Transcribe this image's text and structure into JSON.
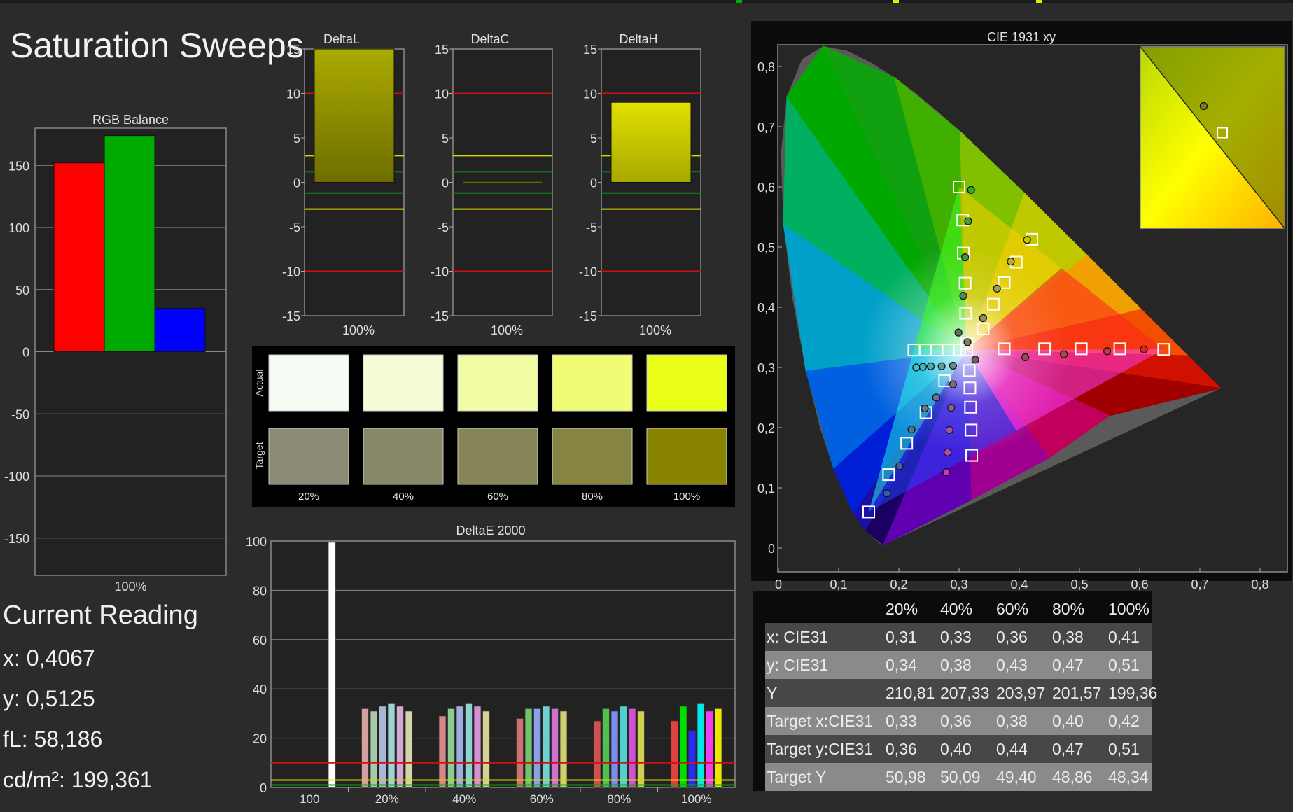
{
  "title": "Saturation Sweeps",
  "topbar_colors": [
    "#00b000",
    "#e8e800",
    "#e8e800"
  ],
  "current_reading": {
    "heading": "Current Reading",
    "x": "x: 0,4067",
    "y": "y: 0,5125",
    "fl": "fL: 58,186",
    "cdm2": "cd/m²: 199,361"
  },
  "swatches": {
    "actual_label": "Actual",
    "target_label": "Target",
    "labels": [
      "20%",
      "40%",
      "60%",
      "80%",
      "100%"
    ],
    "actual_colors": [
      "#f4fcf4",
      "#f4fcd6",
      "#f2fca4",
      "#f0fc74",
      "#eaff18"
    ],
    "target_colors": [
      "#8b8a74",
      "#888868",
      "#858558",
      "#868440",
      "#888400"
    ]
  },
  "table": {
    "headers": [
      "",
      "20%",
      "40%",
      "60%",
      "80%",
      "100%"
    ],
    "rows": [
      [
        "x: CIE31",
        "0,31",
        "0,33",
        "0,36",
        "0,38",
        "0,41"
      ],
      [
        "y: CIE31",
        "0,34",
        "0,38",
        "0,43",
        "0,47",
        "0,51"
      ],
      [
        "Y",
        "210,81",
        "207,33",
        "203,97",
        "201,57",
        "199,36"
      ],
      [
        "Target x:CIE31",
        "0,33",
        "0,36",
        "0,38",
        "0,40",
        "0,42"
      ],
      [
        "Target y:CIE31",
        "0,36",
        "0,40",
        "0,44",
        "0,47",
        "0,51"
      ],
      [
        "Target Y",
        "50,98",
        "50,09",
        "49,40",
        "48,86",
        "48,34"
      ]
    ]
  },
  "chart_data": [
    {
      "type": "bar",
      "title": "RGB Balance",
      "categories": [
        "100%"
      ],
      "series": [
        {
          "name": "Red",
          "color": "#ff0000",
          "values": [
            152
          ]
        },
        {
          "name": "Green",
          "color": "#00aa00",
          "values": [
            174
          ]
        },
        {
          "name": "Blue",
          "color": "#0000ff",
          "values": [
            35
          ]
        }
      ],
      "ylim": [
        -180,
        180
      ],
      "yticks": [
        150,
        100,
        50,
        0,
        -50,
        -100,
        -150
      ]
    },
    {
      "type": "bar",
      "title": "DeltaL",
      "categories": [
        "100%"
      ],
      "values": [
        15
      ],
      "ylim": [
        -15,
        15
      ],
      "yticks": [
        15,
        10,
        5,
        0,
        -5,
        -10,
        -15
      ],
      "bar_color": "#999900"
    },
    {
      "type": "bar",
      "title": "DeltaC",
      "categories": [
        "100%"
      ],
      "values": [
        0.1
      ],
      "ylim": [
        -15,
        15
      ],
      "yticks": [
        15,
        10,
        5,
        0,
        -5,
        -10,
        -15
      ],
      "bar_color": "#999900"
    },
    {
      "type": "bar",
      "title": "DeltaH",
      "categories": [
        "100%"
      ],
      "values": [
        9
      ],
      "ylim": [
        -15,
        15
      ],
      "yticks": [
        15,
        10,
        5,
        0,
        -5,
        -10,
        -15
      ],
      "bar_color": "#cccc00"
    },
    {
      "type": "bar",
      "title": "DeltaE 2000",
      "ylim": [
        0,
        100
      ],
      "yticks": [
        100,
        80,
        60,
        40,
        20,
        0
      ],
      "categories": [
        "100",
        "20%",
        "40%",
        "60%",
        "80%",
        "100%"
      ],
      "threshold_lines": [
        {
          "value": 10,
          "color": "#d01010"
        },
        {
          "value": 3,
          "color": "#d8d800"
        },
        {
          "value": 1,
          "color": "#10a010"
        }
      ],
      "groups": [
        {
          "label": "100",
          "bars": [
            {
              "value": 99.5,
              "color": "#ffffff"
            }
          ]
        },
        {
          "label": "20%",
          "bars": [
            {
              "value": 32,
              "color": "#d4a0a0"
            },
            {
              "value": 31,
              "color": "#a8c8a8"
            },
            {
              "value": 33,
              "color": "#a8b8d4"
            },
            {
              "value": 34,
              "color": "#a0d4d4"
            },
            {
              "value": 33,
              "color": "#d4a8d4"
            },
            {
              "value": 31,
              "color": "#d4d4a8"
            }
          ]
        },
        {
          "label": "40%",
          "bars": [
            {
              "value": 29,
              "color": "#d48888"
            },
            {
              "value": 32,
              "color": "#8ccc8c"
            },
            {
              "value": 33,
              "color": "#9aaee0"
            },
            {
              "value": 34,
              "color": "#8cd4d4"
            },
            {
              "value": 33,
              "color": "#d490d4"
            },
            {
              "value": 31,
              "color": "#d4d490"
            }
          ]
        },
        {
          "label": "60%",
          "bars": [
            {
              "value": 28,
              "color": "#d07070"
            },
            {
              "value": 32,
              "color": "#70c470"
            },
            {
              "value": 32,
              "color": "#8aa0e8"
            },
            {
              "value": 33,
              "color": "#70d0d0"
            },
            {
              "value": 32,
              "color": "#d070d0"
            },
            {
              "value": 31,
              "color": "#d0d070"
            }
          ]
        },
        {
          "label": "80%",
          "bars": [
            {
              "value": 27,
              "color": "#d05050"
            },
            {
              "value": 32,
              "color": "#50c050"
            },
            {
              "value": 31,
              "color": "#7a8cf0"
            },
            {
              "value": 33,
              "color": "#50d0d0"
            },
            {
              "value": 32,
              "color": "#d050d0"
            },
            {
              "value": 31,
              "color": "#d0d050"
            }
          ]
        },
        {
          "label": "100%",
          "bars": [
            {
              "value": 27,
              "color": "#e04040"
            },
            {
              "value": 33,
              "color": "#00e000"
            },
            {
              "value": 23,
              "color": "#2828ff"
            },
            {
              "value": 34,
              "color": "#00e8e8"
            },
            {
              "value": 31,
              "color": "#f040f0"
            },
            {
              "value": 32,
              "color": "#e8e800"
            }
          ]
        }
      ]
    },
    {
      "type": "scatter",
      "title": "CIE 1931 xy",
      "xlim": [
        0,
        0.85
      ],
      "ylim": [
        0,
        0.85
      ],
      "xticks": [
        0,
        0.1,
        0.2,
        0.3,
        0.4,
        0.5,
        0.6,
        0.7,
        0.8
      ],
      "yticks": [
        0,
        0.1,
        0.2,
        0.3,
        0.4,
        0.5,
        0.6,
        0.7,
        0.8
      ],
      "xtick_labels": [
        "0",
        "0,1",
        "0,2",
        "0,3",
        "0,4",
        "0,5",
        "0,6",
        "0,7",
        "0,8"
      ],
      "ytick_labels": [
        "0",
        "0,1",
        "0,2",
        "0,3",
        "0,4",
        "0,5",
        "0,6",
        "0,7",
        "0,8"
      ],
      "gamut_triangle": [
        [
          0.64,
          0.33
        ],
        [
          0.3,
          0.6
        ],
        [
          0.15,
          0.06
        ]
      ],
      "targets": [
        [
          0.64,
          0.33
        ],
        [
          0.567,
          0.331
        ],
        [
          0.503,
          0.331
        ],
        [
          0.442,
          0.331
        ],
        [
          0.375,
          0.331
        ],
        [
          0.3,
          0.6
        ],
        [
          0.306,
          0.545
        ],
        [
          0.307,
          0.49
        ],
        [
          0.31,
          0.44
        ],
        [
          0.311,
          0.39
        ],
        [
          0.313,
          0.34
        ],
        [
          0.15,
          0.06
        ],
        [
          0.183,
          0.122
        ],
        [
          0.213,
          0.174
        ],
        [
          0.245,
          0.225
        ],
        [
          0.276,
          0.278
        ],
        [
          0.225,
          0.329
        ],
        [
          0.244,
          0.329
        ],
        [
          0.263,
          0.329
        ],
        [
          0.282,
          0.329
        ],
        [
          0.301,
          0.329
        ],
        [
          0.421,
          0.513
        ],
        [
          0.395,
          0.475
        ],
        [
          0.375,
          0.441
        ],
        [
          0.357,
          0.405
        ],
        [
          0.34,
          0.364
        ],
        [
          0.321,
          0.154
        ],
        [
          0.32,
          0.196
        ],
        [
          0.319,
          0.234
        ],
        [
          0.318,
          0.266
        ],
        [
          0.317,
          0.295
        ],
        [
          0.3127,
          0.329
        ]
      ],
      "measured": [
        {
          "x": 0.607,
          "y": 0.33,
          "color": "#dd2222"
        },
        {
          "x": 0.546,
          "y": 0.327,
          "color": "#c23a3a"
        },
        {
          "x": 0.474,
          "y": 0.322,
          "color": "#ab4a4a"
        },
        {
          "x": 0.41,
          "y": 0.317,
          "color": "#944f4f"
        },
        {
          "x": 0.327,
          "y": 0.313,
          "color": "#6e6060"
        },
        {
          "x": 0.32,
          "y": 0.595,
          "color": "#33aa33"
        },
        {
          "x": 0.315,
          "y": 0.543,
          "color": "#3f9f3f"
        },
        {
          "x": 0.31,
          "y": 0.483,
          "color": "#4a944a"
        },
        {
          "x": 0.307,
          "y": 0.419,
          "color": "#558955"
        },
        {
          "x": 0.299,
          "y": 0.358,
          "color": "#607060"
        },
        {
          "x": 0.18,
          "y": 0.091,
          "color": "#3a5aa8"
        },
        {
          "x": 0.201,
          "y": 0.136,
          "color": "#4a6098"
        },
        {
          "x": 0.221,
          "y": 0.197,
          "color": "#567090"
        },
        {
          "x": 0.243,
          "y": 0.232,
          "color": "#617590"
        },
        {
          "x": 0.262,
          "y": 0.25,
          "color": "#6b7090"
        },
        {
          "x": 0.229,
          "y": 0.3,
          "color": "#33c8c8"
        },
        {
          "x": 0.24,
          "y": 0.301,
          "color": "#44b8b8"
        },
        {
          "x": 0.253,
          "y": 0.302,
          "color": "#55a8a8"
        },
        {
          "x": 0.271,
          "y": 0.302,
          "color": "#609898"
        },
        {
          "x": 0.29,
          "y": 0.303,
          "color": "#688888"
        },
        {
          "x": 0.413,
          "y": 0.512,
          "color": "#c8c800"
        },
        {
          "x": 0.386,
          "y": 0.476,
          "color": "#b2b230"
        },
        {
          "x": 0.363,
          "y": 0.431,
          "color": "#a0a048"
        },
        {
          "x": 0.34,
          "y": 0.382,
          "color": "#909058"
        },
        {
          "x": 0.314,
          "y": 0.342,
          "color": "#808068"
        },
        {
          "x": 0.279,
          "y": 0.126,
          "color": "#cc33cc"
        },
        {
          "x": 0.281,
          "y": 0.159,
          "color": "#b448b4"
        },
        {
          "x": 0.284,
          "y": 0.196,
          "color": "#a055a0"
        },
        {
          "x": 0.287,
          "y": 0.233,
          "color": "#906090"
        },
        {
          "x": 0.29,
          "y": 0.272,
          "color": "#806a80"
        }
      ],
      "inset": {
        "measured": [
          0.4067,
          0.5125
        ],
        "target": [
          0.42,
          0.51
        ]
      }
    }
  ]
}
